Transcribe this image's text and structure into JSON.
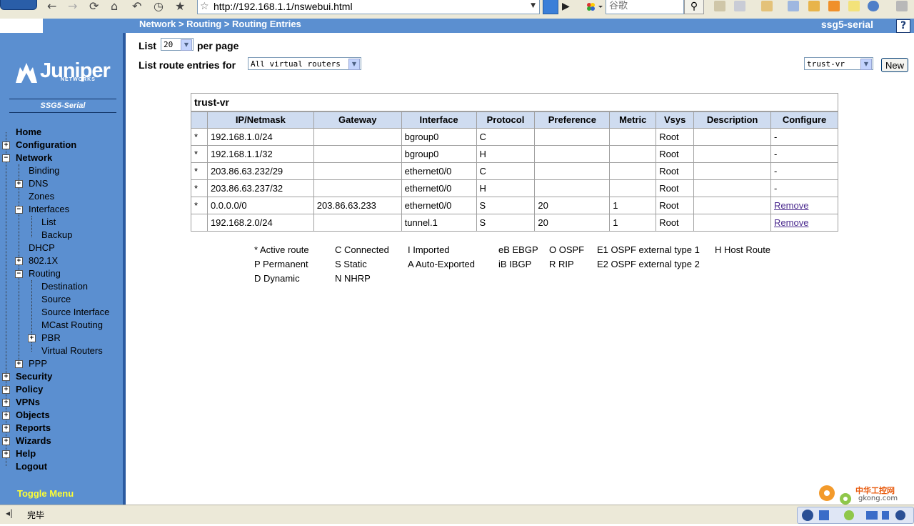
{
  "browser": {
    "url": "http://192.168.1.1/nswebui.html",
    "search_placeholder": "谷歌"
  },
  "header": {
    "breadcrumb": "Network > Routing > Routing Entries",
    "device_name": "ssg5-serial",
    "help_label": "?"
  },
  "sidebar": {
    "logo_text": "Juniper",
    "logo_sub": "NETWORKS",
    "model": "SSG5-Serial",
    "items": [
      {
        "label": "Home"
      },
      {
        "label": "Configuration"
      },
      {
        "label": "Network"
      },
      {
        "label": "Binding"
      },
      {
        "label": "DNS"
      },
      {
        "label": "Zones"
      },
      {
        "label": "Interfaces"
      },
      {
        "label": "List"
      },
      {
        "label": "Backup"
      },
      {
        "label": "DHCP"
      },
      {
        "label": "802.1X"
      },
      {
        "label": "Routing"
      },
      {
        "label": "Destination"
      },
      {
        "label": "Source"
      },
      {
        "label": "Source Interface"
      },
      {
        "label": "MCast Routing"
      },
      {
        "label": "PBR"
      },
      {
        "label": "Virtual Routers"
      },
      {
        "label": "PPP"
      },
      {
        "label": "Security"
      },
      {
        "label": "Policy"
      },
      {
        "label": "VPNs"
      },
      {
        "label": "Objects"
      },
      {
        "label": "Reports"
      },
      {
        "label": "Wizards"
      },
      {
        "label": "Help"
      },
      {
        "label": "Logout"
      }
    ],
    "toggle_menu": "Toggle Menu"
  },
  "controls": {
    "list_label": "List",
    "list_value": "20",
    "per_page_label": "per page",
    "route_for_label": "List route entries for",
    "vr_filter_value": "All virtual routers",
    "vr_select_value": "trust-vr",
    "new_button": "New"
  },
  "table": {
    "title": "trust-vr",
    "headers": [
      "",
      "IP/Netmask",
      "Gateway",
      "Interface",
      "Protocol",
      "Preference",
      "Metric",
      "Vsys",
      "Description",
      "Configure"
    ],
    "rows": [
      {
        "active": "*",
        "ip": "192.168.1.0/24",
        "gateway": "",
        "interface": "bgroup0",
        "protocol": "C",
        "preference": "",
        "metric": "",
        "vsys": "Root",
        "description": "",
        "configure": "-"
      },
      {
        "active": "*",
        "ip": "192.168.1.1/32",
        "gateway": "",
        "interface": "bgroup0",
        "protocol": "H",
        "preference": "",
        "metric": "",
        "vsys": "Root",
        "description": "",
        "configure": "-"
      },
      {
        "active": "*",
        "ip": "203.86.63.232/29",
        "gateway": "",
        "interface": "ethernet0/0",
        "protocol": "C",
        "preference": "",
        "metric": "",
        "vsys": "Root",
        "description": "",
        "configure": "-"
      },
      {
        "active": "*",
        "ip": "203.86.63.237/32",
        "gateway": "",
        "interface": "ethernet0/0",
        "protocol": "H",
        "preference": "",
        "metric": "",
        "vsys": "Root",
        "description": "",
        "configure": "-"
      },
      {
        "active": "*",
        "ip": "0.0.0.0/0",
        "gateway": "203.86.63.233",
        "interface": "ethernet0/0",
        "protocol": "S",
        "preference": "20",
        "metric": "1",
        "vsys": "Root",
        "description": "",
        "configure": "Remove"
      },
      {
        "active": "",
        "ip": "192.168.2.0/24",
        "gateway": "",
        "interface": "tunnel.1",
        "protocol": "S",
        "preference": "20",
        "metric": "1",
        "vsys": "Root",
        "description": "",
        "configure": "Remove"
      }
    ]
  },
  "legend": {
    "row1": [
      "* Active route",
      "C Connected",
      "I  Imported",
      "eB EBGP",
      "O OSPF",
      "E1 OSPF external type 1",
      "H Host Route"
    ],
    "row2": [
      "P Permanent",
      "S Static",
      "A Auto-Exported",
      "iB  IBGP",
      "R RIP",
      "E2 OSPF external type 2"
    ],
    "row3": [
      "D Dynamic",
      "N NHRP"
    ]
  },
  "status": {
    "text": "完毕"
  },
  "watermark": {
    "title": "中华工控网",
    "url": "gkong.com"
  },
  "colors": {
    "sidebar": "#5b8fd0",
    "table_header": "#cfdcf0",
    "toggle_menu": "#ffff33"
  }
}
